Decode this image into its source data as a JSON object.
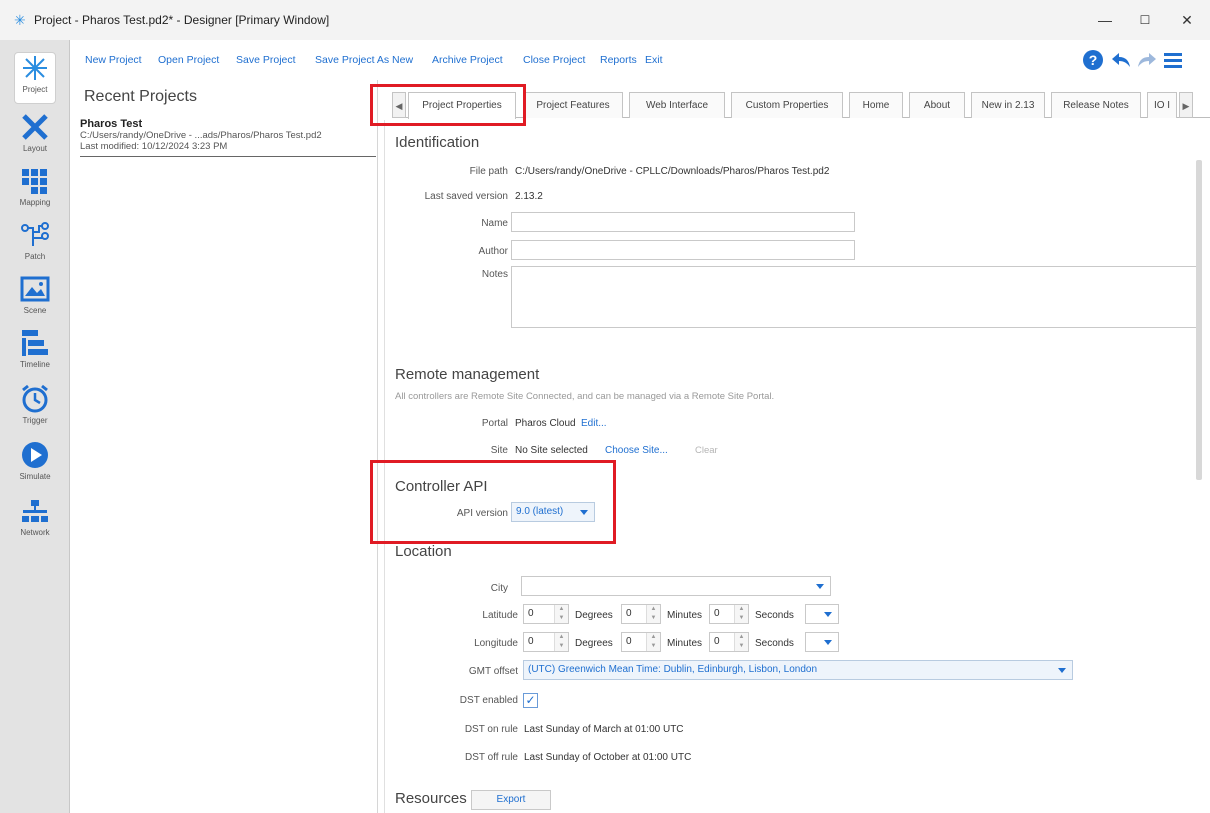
{
  "window": {
    "title": "Project - Pharos Test.pd2* - Designer [Primary Window]",
    "minimize": "—",
    "maximize": "☐",
    "close": "✕"
  },
  "menu": {
    "items": [
      "New Project",
      "Open Project",
      "Save Project",
      "Save Project As New",
      "Archive Project",
      "Close Project",
      "Reports",
      "Exit"
    ]
  },
  "sidebar": {
    "items": [
      {
        "label": "Project",
        "icon": "project-icon"
      },
      {
        "label": "Layout",
        "icon": "layout-icon"
      },
      {
        "label": "Mapping",
        "icon": "mapping-icon"
      },
      {
        "label": "Patch",
        "icon": "patch-icon"
      },
      {
        "label": "Scene",
        "icon": "scene-icon"
      },
      {
        "label": "Timeline",
        "icon": "timeline-icon"
      },
      {
        "label": "Trigger",
        "icon": "trigger-icon"
      },
      {
        "label": "Simulate",
        "icon": "simulate-icon"
      },
      {
        "label": "Network",
        "icon": "network-icon"
      }
    ]
  },
  "recent": {
    "title": "Recent Projects",
    "items": [
      {
        "name": "Pharos Test",
        "path": "C:/Users/randy/OneDrive - ...ads/Pharos/Pharos Test.pd2",
        "modified": "Last modified: 10/12/2024 3:23 PM"
      }
    ]
  },
  "tabs": [
    "Project Properties",
    "Project Features",
    "Web Interface",
    "Custom Properties",
    "Home",
    "About",
    "New in 2.13",
    "Release Notes",
    "IO I"
  ],
  "identification": {
    "title": "Identification",
    "file_path_label": "File path",
    "file_path": "C:/Users/randy/OneDrive - CPLLC/Downloads/Pharos/Pharos Test.pd2",
    "last_saved_label": "Last saved version",
    "last_saved": "2.13.2",
    "name_label": "Name",
    "author_label": "Author",
    "notes_label": "Notes"
  },
  "remote": {
    "title": "Remote management",
    "description": "All controllers are Remote Site Connected, and can be managed via a Remote Site Portal.",
    "portal_label": "Portal",
    "portal_value": "Pharos Cloud",
    "portal_edit": "Edit...",
    "site_label": "Site",
    "site_value": "No Site selected",
    "site_choose": "Choose Site...",
    "site_clear": "Clear"
  },
  "controller_api": {
    "title": "Controller API",
    "api_version_label": "API version",
    "api_version": "9.0 (latest)"
  },
  "location": {
    "title": "Location",
    "city_label": "City",
    "city_value": "",
    "latitude_label": "Latitude",
    "longitude_label": "Longitude",
    "lat_degrees": "0",
    "lat_minutes": "0",
    "lat_seconds": "0",
    "lon_degrees": "0",
    "lon_minutes": "0",
    "lon_seconds": "0",
    "degrees_label": "Degrees",
    "minutes_label": "Minutes",
    "seconds_label": "Seconds",
    "gmt_label": "GMT offset",
    "gmt_value": "(UTC) Greenwich Mean Time: Dublin, Edinburgh, Lisbon, London",
    "dst_enabled_label": "DST enabled",
    "dst_enabled": true,
    "dst_check_glyph": "✓",
    "dst_on_label": "DST on rule",
    "dst_on_value": "Last Sunday of March at 01:00 UTC",
    "dst_off_label": "DST off rule",
    "dst_off_value": "Last Sunday of October at 01:00 UTC"
  },
  "resources": {
    "title": "Resources",
    "export_label": "Export"
  },
  "colors": {
    "accent": "#1f6fd0",
    "highlight": "#e01b24"
  }
}
